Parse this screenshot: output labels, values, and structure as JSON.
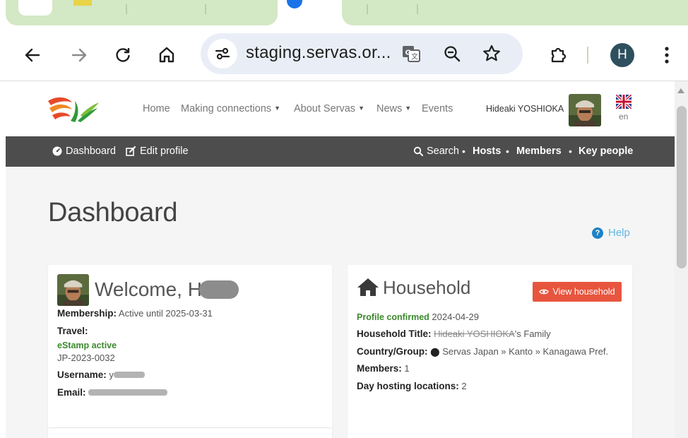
{
  "browser": {
    "url": "staging.servas.or...",
    "profile_initial": "H"
  },
  "site": {
    "nav": {
      "home": "Home",
      "making_connections": "Making connections",
      "about": "About Servas",
      "news": "News",
      "events": "Events",
      "user_name": "Hideaki YOSHIOKA",
      "lang": "en"
    },
    "subnav": {
      "dashboard": "Dashboard",
      "edit_profile": "Edit profile",
      "search": "Search",
      "hosts": "Hosts",
      "members": "Members",
      "key_people": "Key people"
    },
    "page_title": "Dashboard",
    "help": "Help"
  },
  "welcome": {
    "title_prefix": "Welcome, H",
    "membership_label": "Membership:",
    "membership_value": "Active until 2025-03-31",
    "travel_label": "Travel:",
    "estamp_status": "eStamp active",
    "estamp_id": "JP-2023-0032",
    "username_label": "Username:",
    "username_value": "y",
    "email_label": "Email:"
  },
  "household": {
    "title": "Household",
    "view_button": "View household",
    "profile_confirmed_label": "Profile confirmed",
    "profile_confirmed_date": "2024-04-29",
    "household_title_label": "Household Title:",
    "household_title_name": "Hideaki YOSHIOKA",
    "household_title_suffix": "'s Family",
    "country_group_label": "Country/Group:",
    "country_group_value": "Servas Japan » Kanto » Kanagawa Pref.",
    "members_label": "Members:",
    "members_value": "1",
    "hosting_label": "Day hosting locations:",
    "hosting_value": "2"
  },
  "colors": {
    "accent_green": "#3c8a2e",
    "button_red": "#e8553e",
    "subnav_bg": "#4d4d4d",
    "help_blue": "#1f82c5"
  }
}
